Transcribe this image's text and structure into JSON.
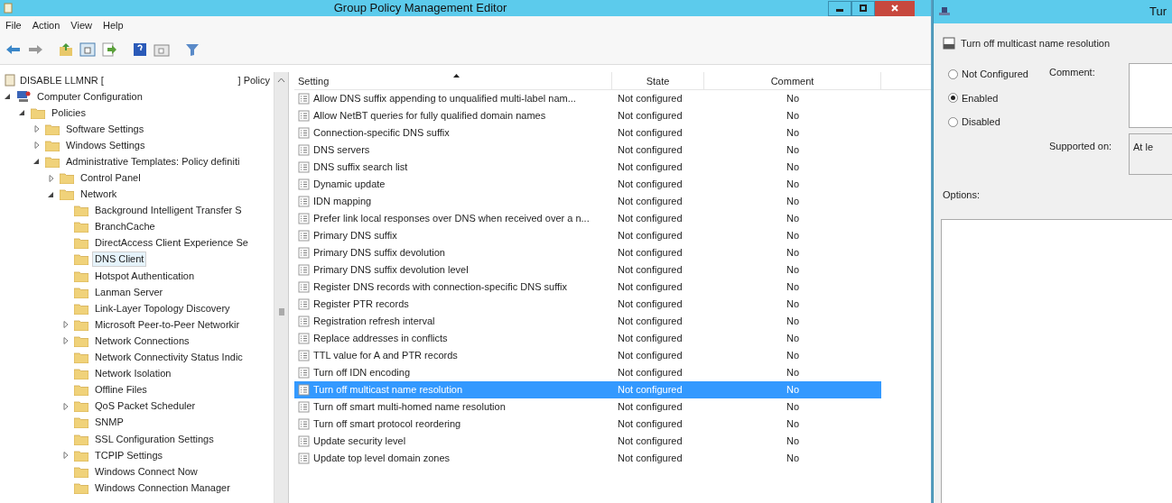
{
  "window": {
    "title": "Group Policy Management Editor"
  },
  "menu": [
    "File",
    "Action",
    "View",
    "Help"
  ],
  "tree": {
    "root": {
      "label": "DISABLE LLMNR [",
      "label_end": "] Policy"
    },
    "items": [
      {
        "label": "Computer Configuration",
        "kind": "computer",
        "expanded": true,
        "selected": false,
        "children": [
          {
            "label": "Policies",
            "kind": "folder",
            "expanded": true,
            "selected": false,
            "children": [
              {
                "label": "Software Settings",
                "kind": "folder",
                "expanded": false,
                "selected": false
              },
              {
                "label": "Windows Settings",
                "kind": "folder",
                "expanded": false,
                "selected": false
              },
              {
                "label": "Administrative Templates: Policy definiti",
                "kind": "folder",
                "expanded": true,
                "selected": false,
                "children": [
                  {
                    "label": "Control Panel",
                    "kind": "folder",
                    "expanded": false,
                    "selected": false
                  },
                  {
                    "label": "Network",
                    "kind": "folder",
                    "expanded": true,
                    "selected": false,
                    "children": [
                      {
                        "label": "Background Intelligent Transfer S",
                        "kind": "folder",
                        "selected": false
                      },
                      {
                        "label": "BranchCache",
                        "kind": "folder",
                        "selected": false
                      },
                      {
                        "label": "DirectAccess Client Experience Se",
                        "kind": "folder",
                        "selected": false
                      },
                      {
                        "label": "DNS Client",
                        "kind": "folder",
                        "selected": true
                      },
                      {
                        "label": "Hotspot Authentication",
                        "kind": "folder",
                        "selected": false
                      },
                      {
                        "label": "Lanman Server",
                        "kind": "folder",
                        "selected": false
                      },
                      {
                        "label": "Link-Layer Topology Discovery",
                        "kind": "folder",
                        "selected": false
                      },
                      {
                        "label": "Microsoft Peer-to-Peer Networkir",
                        "kind": "folder",
                        "expanded": false,
                        "selected": false
                      },
                      {
                        "label": "Network Connections",
                        "kind": "folder",
                        "expanded": false,
                        "selected": false
                      },
                      {
                        "label": "Network Connectivity Status Indic",
                        "kind": "folder",
                        "selected": false
                      },
                      {
                        "label": "Network Isolation",
                        "kind": "folder",
                        "selected": false
                      },
                      {
                        "label": "Offline Files",
                        "kind": "folder",
                        "selected": false
                      },
                      {
                        "label": "QoS Packet Scheduler",
                        "kind": "folder",
                        "expanded": false,
                        "selected": false
                      },
                      {
                        "label": "SNMP",
                        "kind": "folder",
                        "selected": false
                      },
                      {
                        "label": "SSL Configuration Settings",
                        "kind": "folder",
                        "selected": false
                      },
                      {
                        "label": "TCPIP Settings",
                        "kind": "folder",
                        "expanded": false,
                        "selected": false
                      },
                      {
                        "label": "Windows Connect Now",
                        "kind": "folder",
                        "selected": false
                      },
                      {
                        "label": "Windows Connection Manager",
                        "kind": "folder",
                        "selected": false
                      }
                    ]
                  }
                ]
              }
            ]
          }
        ]
      }
    ]
  },
  "table": {
    "columns": [
      "Setting",
      "State",
      "Comment"
    ],
    "rows": [
      {
        "setting": "Allow DNS suffix appending to unqualified multi-label nam...",
        "state": "Not configured",
        "comment": "No",
        "selected": false
      },
      {
        "setting": "Allow NetBT queries for fully qualified domain names",
        "state": "Not configured",
        "comment": "No",
        "selected": false
      },
      {
        "setting": "Connection-specific DNS suffix",
        "state": "Not configured",
        "comment": "No",
        "selected": false
      },
      {
        "setting": "DNS servers",
        "state": "Not configured",
        "comment": "No",
        "selected": false
      },
      {
        "setting": "DNS suffix search list",
        "state": "Not configured",
        "comment": "No",
        "selected": false
      },
      {
        "setting": "Dynamic update",
        "state": "Not configured",
        "comment": "No",
        "selected": false
      },
      {
        "setting": "IDN mapping",
        "state": "Not configured",
        "comment": "No",
        "selected": false
      },
      {
        "setting": "Prefer link local responses over DNS when received over a n...",
        "state": "Not configured",
        "comment": "No",
        "selected": false
      },
      {
        "setting": "Primary DNS suffix",
        "state": "Not configured",
        "comment": "No",
        "selected": false
      },
      {
        "setting": "Primary DNS suffix devolution",
        "state": "Not configured",
        "comment": "No",
        "selected": false
      },
      {
        "setting": "Primary DNS suffix devolution level",
        "state": "Not configured",
        "comment": "No",
        "selected": false
      },
      {
        "setting": "Register DNS records with connection-specific DNS suffix",
        "state": "Not configured",
        "comment": "No",
        "selected": false
      },
      {
        "setting": "Register PTR records",
        "state": "Not configured",
        "comment": "No",
        "selected": false
      },
      {
        "setting": "Registration refresh interval",
        "state": "Not configured",
        "comment": "No",
        "selected": false
      },
      {
        "setting": "Replace addresses in conflicts",
        "state": "Not configured",
        "comment": "No",
        "selected": false
      },
      {
        "setting": "TTL value for A and PTR records",
        "state": "Not configured",
        "comment": "No",
        "selected": false
      },
      {
        "setting": "Turn off IDN encoding",
        "state": "Not configured",
        "comment": "No",
        "selected": false
      },
      {
        "setting": "Turn off multicast name resolution",
        "state": "Not configured",
        "comment": "No",
        "selected": true
      },
      {
        "setting": "Turn off smart multi-homed name resolution",
        "state": "Not configured",
        "comment": "No",
        "selected": false
      },
      {
        "setting": "Turn off smart protocol reordering",
        "state": "Not configured",
        "comment": "No",
        "selected": false
      },
      {
        "setting": "Update security level",
        "state": "Not configured",
        "comment": "No",
        "selected": false
      },
      {
        "setting": "Update top level domain zones",
        "state": "Not configured",
        "comment": "No",
        "selected": false
      }
    ]
  },
  "dialog": {
    "title": "Tur",
    "heading": "Turn off multicast name resolution",
    "options": [
      {
        "label": "Not Configured",
        "selected": false
      },
      {
        "label": "Enabled",
        "selected": true
      },
      {
        "label": "Disabled",
        "selected": false
      }
    ],
    "comment_label": "Comment:",
    "supported_label": "Supported on:",
    "supported_value": "At le",
    "options_label": "Options:"
  }
}
